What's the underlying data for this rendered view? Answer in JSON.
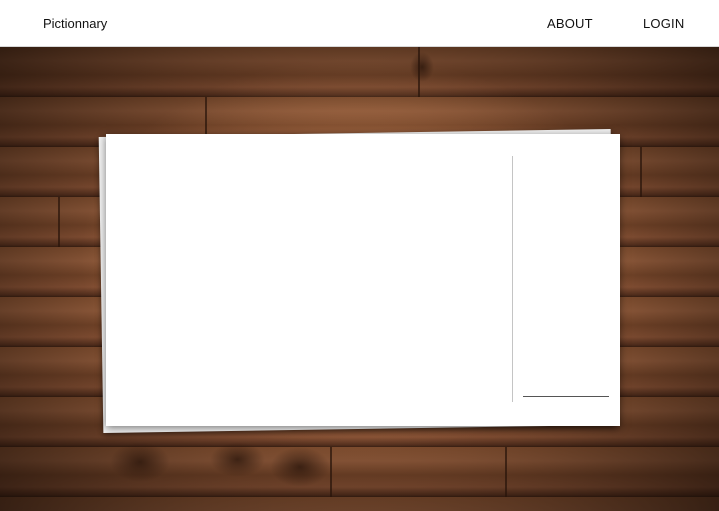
{
  "navbar": {
    "brand": "Pictionnary",
    "links": [
      {
        "label": "ABOUT"
      },
      {
        "label": "LOGIN"
      }
    ]
  },
  "board": {
    "guess_value": "",
    "guess_placeholder": ""
  }
}
